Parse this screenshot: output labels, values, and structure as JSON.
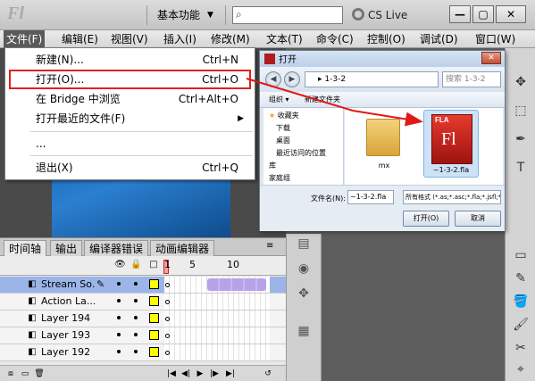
{
  "app": {
    "logo_text": "Fl",
    "workspace_label": "基本功能",
    "workspace_caret": "▼",
    "search_icon": "⌕",
    "cslive_label": "CS Live",
    "window_buttons": {
      "minimize": "—",
      "maximize": "▢",
      "close": "✕"
    }
  },
  "menubar": {
    "items": [
      "文件(F)",
      "编辑(E)",
      "视图(V)",
      "插入(I)",
      "修改(M)",
      "文本(T)",
      "命令(C)",
      "控制(O)",
      "调试(D)",
      "窗口(W)"
    ]
  },
  "file_menu": {
    "items": [
      {
        "label": "新建(N)...",
        "shortcut": "Ctrl+N"
      },
      {
        "label": "打开(O)...",
        "shortcut": "Ctrl+O",
        "highlighted": true
      },
      {
        "label": "在 Bridge 中浏览",
        "shortcut": "Ctrl+Alt+O"
      },
      {
        "label": "打开最近的文件(F)",
        "shortcut": "",
        "submenu": true
      },
      {
        "label": "...",
        "shortcut": ""
      },
      {
        "label": "退出(X)",
        "shortcut": "Ctrl+Q"
      }
    ],
    "submenu_arrow": "▶"
  },
  "open_dialog": {
    "title": "打开",
    "close_glyph": "✕",
    "nav_back": "◀",
    "nav_forward": "▶",
    "path": "▸ 1-3-2",
    "search_placeholder": "搜索 1-3-2",
    "toolbar_organize": "组织 ▾",
    "toolbar_new_folder": "新建文件夹",
    "tree": [
      "收藏夹",
      "下载",
      "桌面",
      "最近访问的位置",
      "库",
      "家庭组"
    ],
    "files": [
      {
        "name": "mx",
        "type": "folder"
      },
      {
        "name": "~1-3-2.fla",
        "type": "fla",
        "tag": "FLA",
        "letters": "Fl"
      }
    ],
    "filename_label": "文件名(N):",
    "filename_value": "~1-3-2.fla",
    "filetype_value": "所有格式 (*.as;*.asc;*.fla;*.jsfl;*",
    "open_button": "打开(O)",
    "cancel_button": "取消"
  },
  "timeline": {
    "tabs": [
      "时间轴",
      "输出",
      "编译器错误",
      "动画编辑器"
    ],
    "panel_menu": "≡",
    "header_icons": {
      "eye": "👁",
      "lock": "🔒",
      "outline": "□"
    },
    "frame_numbers": [
      "1",
      "5",
      "10"
    ],
    "layers": [
      {
        "name": "Stream So...",
        "selected": true
      },
      {
        "name": "Action La...",
        "selected": false
      },
      {
        "name": "Layer 194",
        "selected": false
      },
      {
        "name": "Layer 193",
        "selected": false
      },
      {
        "name": "Layer 192",
        "selected": false
      }
    ],
    "layer_icon": "◧",
    "pencil_icon": "✎",
    "footer_controls": [
      "⧈",
      "▭",
      "🗑",
      "|◀",
      "◀|",
      "▶",
      "|▶",
      "▶|",
      "↺"
    ]
  },
  "right_toolbar": [
    "✥",
    "⬚",
    "✒",
    "T",
    "▭",
    "✎",
    "🪣",
    "🖌",
    "✂",
    "⌖"
  ],
  "side_panel": [
    "▤",
    "◉",
    "✥",
    "▦"
  ]
}
